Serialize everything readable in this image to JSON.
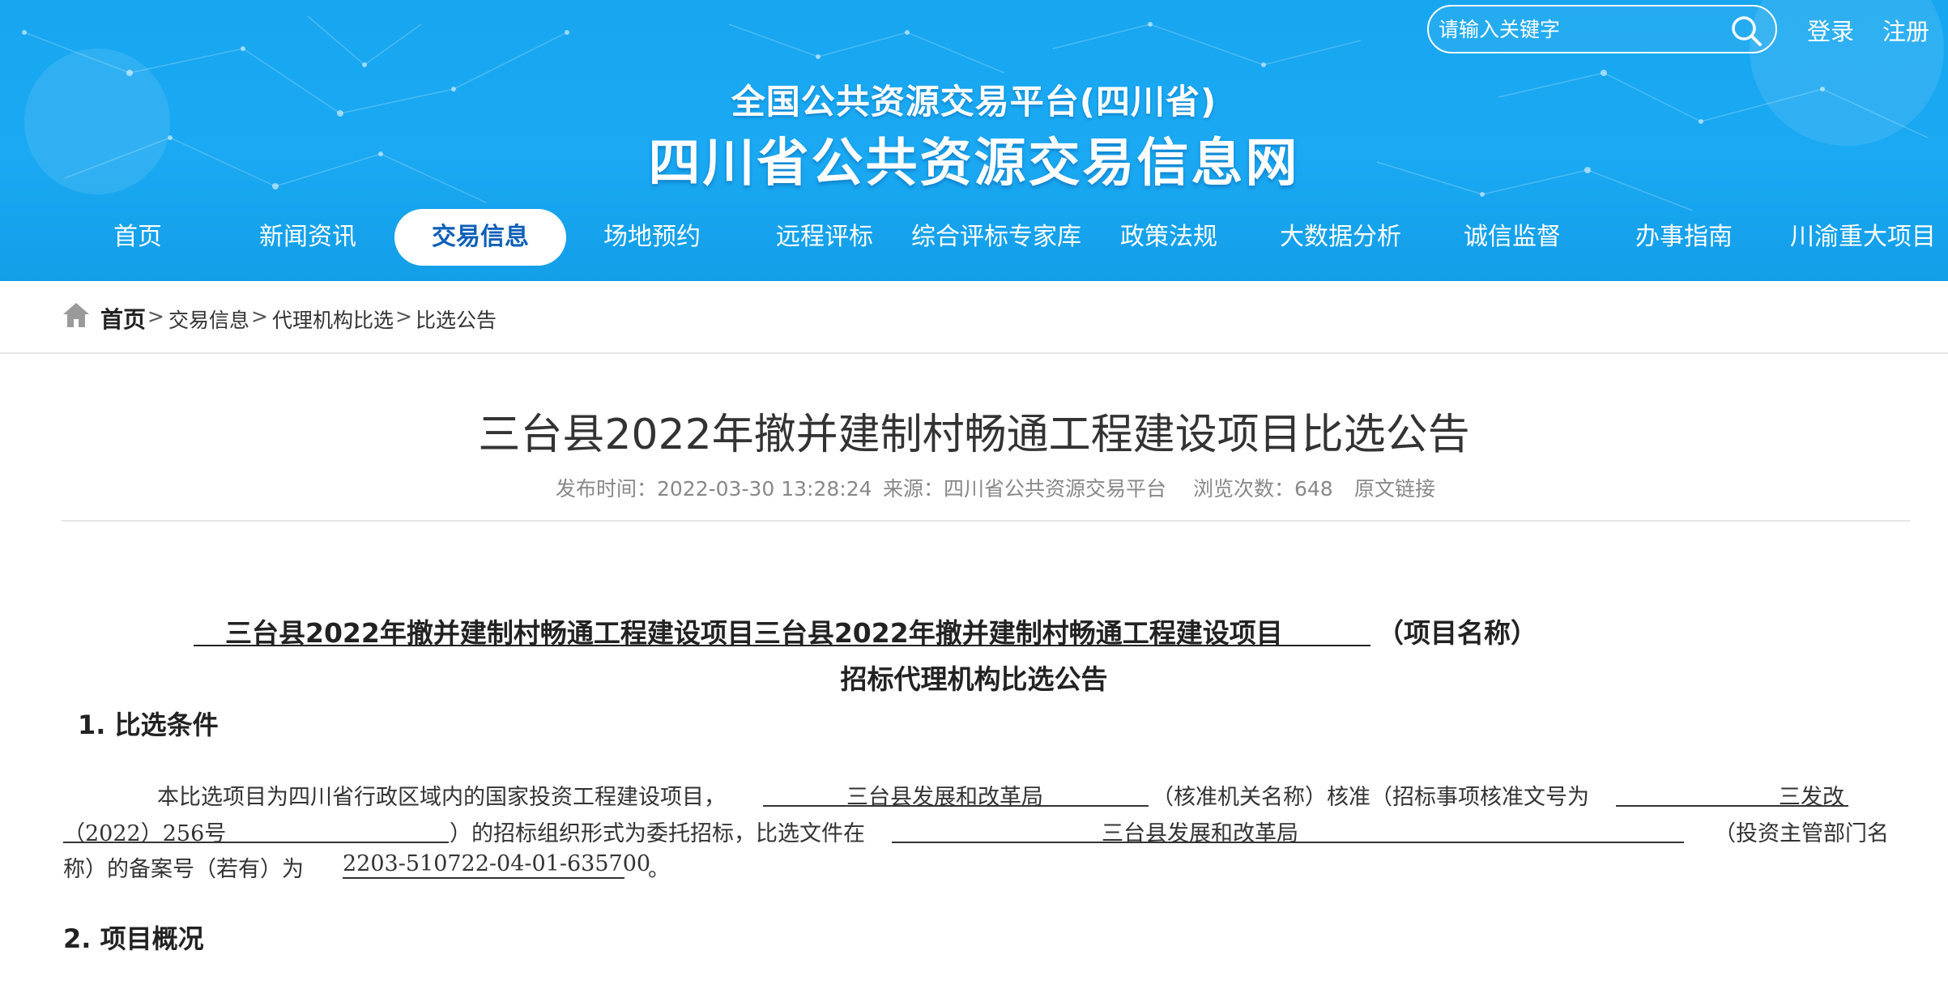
{
  "header": {
    "search_placeholder": "请输入关键字",
    "login": "登录",
    "register": "注册",
    "site_subtitle": "全国公共资源交易平台(四川省)",
    "site_title": "四川省公共资源交易信息网"
  },
  "nav": [
    {
      "label": "首页"
    },
    {
      "label": "新闻资讯"
    },
    {
      "label": "交易信息",
      "active": true
    },
    {
      "label": "场地预约"
    },
    {
      "label": "远程评标"
    },
    {
      "label": "综合评标专家库"
    },
    {
      "label": "政策法规"
    },
    {
      "label": "大数据分析"
    },
    {
      "label": "诚信监督"
    },
    {
      "label": "办事指南"
    },
    {
      "label": "川渝重大项目"
    }
  ],
  "breadcrumb": {
    "home": "首页",
    "items": [
      "交易信息",
      "代理机构比选",
      "比选公告"
    ],
    "separator": ">"
  },
  "article": {
    "title": "三台县2022年撤并建制村畅通工程建设项目比选公告",
    "publish_time": "发布时间：2022-03-30 13:28:24",
    "source": "来源：四川省公共资源交易平台",
    "views": "浏览次数：648",
    "original_link": "原文链接"
  },
  "content": {
    "heading_project": "三台县2022年撤并建制村畅通工程建设项目三台县2022年撤并建制村畅通工程建设项目",
    "heading_suffix": "（项目名称）",
    "heading_sub": "招标代理机构比选公告",
    "section1": "1.  比选条件",
    "p1_a": "本比选项目为四川省行政区域内的国家投资工程建设项目，",
    "p1_approver": "三台县发展和改革局",
    "p1_b": "（核准机关名称）核准（招标事项核准文号为",
    "p1_docno_1": "三发改",
    "p1_docno_2": "（2022）256号",
    "p1_c": "）的招标组织形式为委托招标，比选文件在",
    "p1_dept": "三台县发展和改革局",
    "p1_d": "（投资主管部门名",
    "p1_e": "称）的备案号（若有）为",
    "p1_record": "2203-510722-04-01-635700",
    "p1_end": "。",
    "section2": "2.  项目概况"
  },
  "colors": {
    "banner": "#17a6f0",
    "nav_active_text": "#0d5fb8",
    "meta_text": "#888888"
  }
}
